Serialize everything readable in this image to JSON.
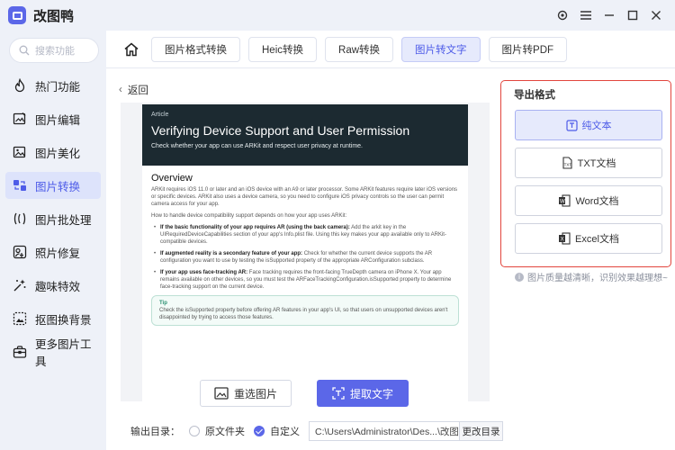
{
  "app": {
    "title": "改图鸭"
  },
  "window_controls": {
    "settings": "⚙",
    "menu": "≡",
    "minimize": "—",
    "maximize": "☐",
    "close": "✕"
  },
  "search": {
    "placeholder": "搜索功能"
  },
  "sidebar": {
    "items": [
      {
        "label": "热门功能",
        "icon": "flame-icon"
      },
      {
        "label": "图片编辑",
        "icon": "image-edit-icon"
      },
      {
        "label": "图片美化",
        "icon": "image-beautify-icon"
      },
      {
        "label": "图片转换",
        "icon": "image-convert-icon",
        "active": true
      },
      {
        "label": "图片批处理",
        "icon": "batch-icon"
      },
      {
        "label": "照片修复",
        "icon": "photo-repair-icon"
      },
      {
        "label": "趣味特效",
        "icon": "sparkle-icon"
      },
      {
        "label": "抠图换背景",
        "icon": "cutout-icon"
      },
      {
        "label": "更多图片工具",
        "icon": "toolbox-icon"
      }
    ]
  },
  "tabs": [
    {
      "label": "图片格式转换"
    },
    {
      "label": "Heic转换"
    },
    {
      "label": "Raw转换"
    },
    {
      "label": "图片转文字",
      "active": true
    },
    {
      "label": "图片转PDF"
    }
  ],
  "back": {
    "label": "返回"
  },
  "document": {
    "eyebrow": "Article",
    "title": "Verifying Device Support and User Permission",
    "subtitle": "Check whether your app can use ARKit and respect user privacy at runtime.",
    "heading": "Overview",
    "p1": "ARKit requires iOS 11.0 or later and an iOS device with an A9 or later processor. Some ARKit features require later iOS versions or specific devices. ARKit also uses a device camera, so you need to configure iOS privacy controls so the user can permit camera access for your app.",
    "p2": "How to handle device compatibility support depends on how your app uses ARKit:",
    "li1_bold": "If the basic functionality of your app requires AR (using the back camera):",
    "li1_text": " Add the arkit key in the UIRequiredDeviceCapabilities section of your app's Info.plist file. Using this key makes your app available only to ARKit-compatible devices.",
    "li2_bold": "If augmented reality is a secondary feature of your app:",
    "li2_text": " Check for whether the current device supports the AR configuration you want to use by testing the isSupported property of the appropriate ARConfiguration subclass.",
    "li3_bold": "If your app uses face-tracking AR:",
    "li3_text": " Face tracking requires the front-facing TrueDepth camera on iPhone X. Your app remains available on other devices, so you must test the ARFaceTrackingConfiguration.isSupported property to determine face-tracking support on the current device.",
    "tip_heading": "Tip",
    "tip_text": "Check the isSupported property before offering AR features in your app's UI, so that users on unsupported devices aren't disappointed by trying to access those features."
  },
  "actions": {
    "reselect": "重选图片",
    "extract": "提取文字"
  },
  "output": {
    "label": "输出目录：",
    "option_original": "原文件夹",
    "option_custom": "自定义",
    "selected": "custom",
    "path": "C:\\Users\\Administrator\\Des...\\改图鸭",
    "change": "更改目录"
  },
  "export_panel": {
    "title": "导出格式",
    "formats": [
      {
        "label": "纯文本",
        "icon": "text-icon",
        "active": true
      },
      {
        "label": "TXT文档",
        "icon": "txt-file-icon"
      },
      {
        "label": "Word文档",
        "icon": "word-icon"
      },
      {
        "label": "Excel文档",
        "icon": "excel-icon"
      }
    ],
    "note": "图片质量越清晰，识别效果越理想~"
  },
  "colors": {
    "accent": "#5b67e8",
    "highlight_border": "#e2453d",
    "sidebar_bg": "#eef1f8"
  }
}
